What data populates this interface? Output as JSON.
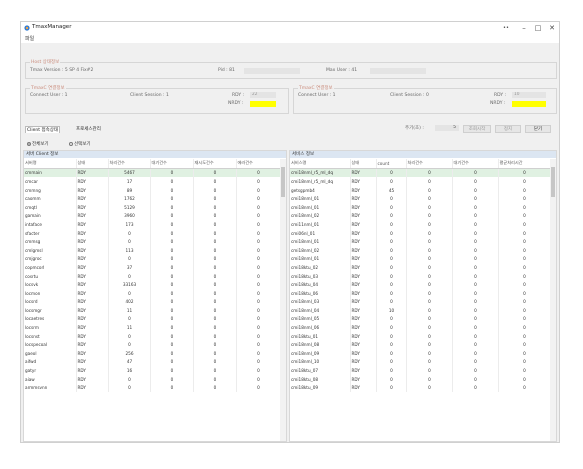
{
  "window": {
    "title": "TmaxManager",
    "controls": [
      "••",
      "–",
      "□",
      "✕"
    ]
  },
  "menu": {
    "items": [
      "파일"
    ]
  },
  "host_info": {
    "group_title": "Host 상태정보",
    "tmax_version_label": "Tmax Version : 5 SP 4 Fix#2",
    "pid_label": "Pid : 81",
    "pid_value": "",
    "max_user_label": "Max User : 41",
    "max_user_value": ""
  },
  "tmax_proc_left": {
    "group_title": "TmaxC 연결정보",
    "connect_user_label": "Connect User : 1",
    "client_session_label": "Client Session : 1",
    "rdy_label": "RDY :",
    "rdy_value": "22",
    "nrdy_label": "NRDY :",
    "nrdy_value": ""
  },
  "tmax_proc_right": {
    "group_title": "TmaxC 연결정보",
    "connect_user_label": "Connect User : 1",
    "client_session_label": "Client Session : 0",
    "rdy_label": "RDY :",
    "rdy_value": "10",
    "nrdy_label": "NRDY :",
    "nrdy_value": ""
  },
  "tabs": [
    "Client 접속상태",
    "프로세스관리"
  ],
  "toolbar": {
    "refresh_label": "주기(초) :",
    "refresh_value": "5",
    "query_button": "조회시작",
    "stop_button": "정지",
    "close_button": "닫기"
  },
  "radios": {
    "option_all": "전체보기",
    "option_selected": "선택보기"
  },
  "left_panel": {
    "title": "서버 Client 정보",
    "columns": [
      "서버명",
      "상태",
      "처리건수",
      "대기건수",
      "재시도건수",
      "에러건수"
    ],
    "rows": [
      [
        "cmmain",
        "RDY",
        "5467",
        "0",
        "0",
        "0"
      ],
      [
        "cmcar",
        "RDY",
        "17",
        "0",
        "0",
        "0"
      ],
      [
        "cmmng",
        "RDY",
        "89",
        "0",
        "0",
        "0"
      ],
      [
        "caomm",
        "RDY",
        "1762",
        "0",
        "0",
        "0"
      ],
      [
        "cmqtl",
        "RDY",
        "5129",
        "0",
        "0",
        "0"
      ],
      [
        "gamain",
        "RDY",
        "3960",
        "0",
        "0",
        "0"
      ],
      [
        "intaface",
        "RDY",
        "173",
        "0",
        "0",
        "0"
      ],
      [
        "sfacter",
        "RDY",
        "0",
        "0",
        "0",
        "0"
      ],
      [
        "cmmsg",
        "RDY",
        "0",
        "0",
        "0",
        "0"
      ],
      [
        "cmlgmsl",
        "RDY",
        "113",
        "0",
        "0",
        "0"
      ],
      [
        "cmjgroc",
        "RDY",
        "0",
        "0",
        "0",
        "0"
      ],
      [
        "copmcorl",
        "RDY",
        "37",
        "0",
        "0",
        "0"
      ],
      [
        "cosrtu",
        "RDY",
        "0",
        "0",
        "0",
        "0"
      ],
      [
        "locsvk",
        "RDY",
        "33163",
        "0",
        "0",
        "0"
      ],
      [
        "locmon",
        "RDY",
        "0",
        "0",
        "0",
        "0"
      ],
      [
        "locsrd",
        "RDY",
        "402",
        "0",
        "0",
        "0"
      ],
      [
        "locsmgr",
        "RDY",
        "11",
        "0",
        "0",
        "0"
      ],
      [
        "locaetres",
        "RDY",
        "0",
        "0",
        "0",
        "0"
      ],
      [
        "locsrm",
        "RDY",
        "11",
        "0",
        "0",
        "0"
      ],
      [
        "locsnst",
        "RDY",
        "0",
        "0",
        "0",
        "0"
      ],
      [
        "locspecoal",
        "RDY",
        "0",
        "0",
        "0",
        "0"
      ],
      [
        "gaeol",
        "RDY",
        "256",
        "0",
        "0",
        "0"
      ],
      [
        "aifwd",
        "RDY",
        "47",
        "0",
        "0",
        "0"
      ],
      [
        "gatyr",
        "RDY",
        "16",
        "0",
        "0",
        "0"
      ],
      [
        "aiaw",
        "RDY",
        "0",
        "0",
        "0",
        "0"
      ],
      [
        "armmsvnn",
        "RDY",
        "0",
        "0",
        "0",
        "0"
      ]
    ]
  },
  "right_panel": {
    "title": "서비스 정보",
    "columns": [
      "서비스명",
      "상태",
      "count",
      "처리건수",
      "대기건수",
      "평균처리시간"
    ],
    "rows": [
      [
        "cmi18nml_r5_ml_dq",
        "RDY",
        "0",
        "0",
        "0",
        "0"
      ],
      [
        "cmi18nml_r5_ml_dq",
        "RDY",
        "0",
        "0",
        "0",
        "0"
      ],
      [
        "getsgpmb4",
        "RDY",
        "45",
        "0",
        "0",
        "0"
      ],
      [
        "cmi18nml_01",
        "RDY",
        "0",
        "0",
        "0",
        "0"
      ],
      [
        "cmi18nml_01",
        "RDY",
        "0",
        "0",
        "0",
        "0"
      ],
      [
        "cmi18nml_02",
        "RDY",
        "0",
        "0",
        "0",
        "0"
      ],
      [
        "cmi11nml_01",
        "RDY",
        "0",
        "0",
        "0",
        "0"
      ],
      [
        "cmi06nl_01",
        "RDY",
        "0",
        "0",
        "0",
        "0"
      ],
      [
        "cmi18nml_01",
        "RDY",
        "0",
        "0",
        "0",
        "0"
      ],
      [
        "cmi18nml_02",
        "RDY",
        "0",
        "0",
        "0",
        "0"
      ],
      [
        "cmi18nml_01",
        "RDY",
        "0",
        "0",
        "0",
        "0"
      ],
      [
        "cmi18ktu_02",
        "RDY",
        "0",
        "0",
        "0",
        "0"
      ],
      [
        "cmi18ktu_03",
        "RDY",
        "0",
        "0",
        "0",
        "0"
      ],
      [
        "cmi18ktu_04",
        "RDY",
        "0",
        "0",
        "0",
        "0"
      ],
      [
        "cmi18ktu_06",
        "RDY",
        "0",
        "0",
        "0",
        "0"
      ],
      [
        "cmi18nml_03",
        "RDY",
        "0",
        "0",
        "0",
        "0"
      ],
      [
        "cmi18nml_04",
        "RDY",
        "10",
        "0",
        "0",
        "0"
      ],
      [
        "cmi18nml_05",
        "RDY",
        "0",
        "0",
        "0",
        "0"
      ],
      [
        "cmi18nml_06",
        "RDY",
        "0",
        "0",
        "0",
        "0"
      ],
      [
        "cmi18ktu_01",
        "RDY",
        "0",
        "0",
        "0",
        "0"
      ],
      [
        "cmi18nml_08",
        "RDY",
        "0",
        "0",
        "0",
        "0"
      ],
      [
        "cmi18nml_09",
        "RDY",
        "0",
        "0",
        "0",
        "0"
      ],
      [
        "cmi18nml_10",
        "RDY",
        "0",
        "0",
        "0",
        "0"
      ],
      [
        "cmi18ktu_07",
        "RDY",
        "0",
        "0",
        "0",
        "0"
      ],
      [
        "cmi18ktu_08",
        "RDY",
        "0",
        "0",
        "0",
        "0"
      ],
      [
        "cmi18ktu_09",
        "RDY",
        "0",
        "0",
        "0",
        "0"
      ]
    ]
  },
  "colors": {
    "accent_yellow": "#ffff00",
    "panel_header": "#dce6f2",
    "selected_row": "#e0f1e2",
    "group_title": "#c98a7a"
  }
}
